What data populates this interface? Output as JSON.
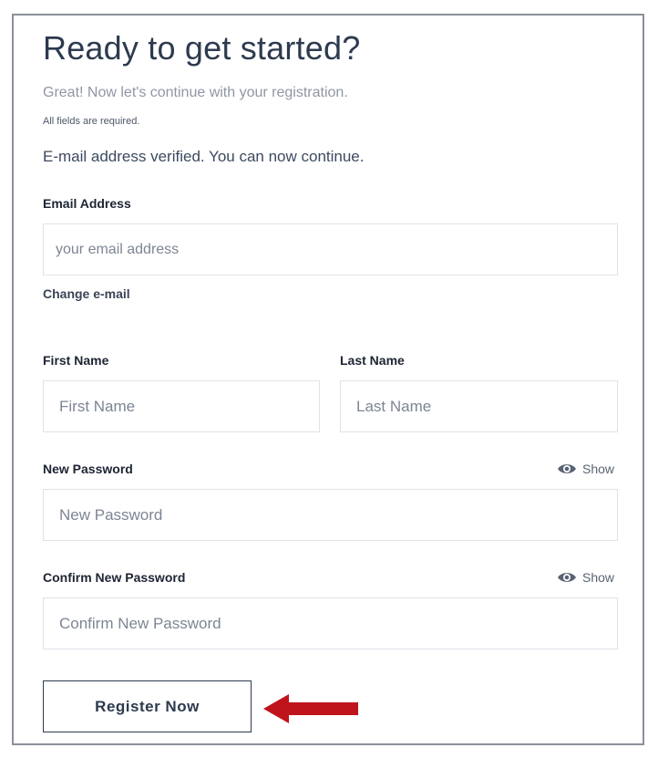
{
  "header": {
    "title": "Ready to get started?",
    "subtitle": "Great! Now let's continue with your registration.",
    "required_note": "All fields are required.",
    "verified_message": "E-mail address verified. You can now continue."
  },
  "form": {
    "email": {
      "label": "Email Address",
      "placeholder": "your email address",
      "value": ""
    },
    "change_email_link": "Change e-mail",
    "first_name": {
      "label": "First Name",
      "placeholder": "First Name",
      "value": ""
    },
    "last_name": {
      "label": "Last Name",
      "placeholder": "Last Name",
      "value": ""
    },
    "new_password": {
      "label": "New Password",
      "placeholder": "New Password",
      "value": "",
      "show_label": "Show"
    },
    "confirm_password": {
      "label": "Confirm New Password",
      "placeholder": "Confirm New Password",
      "value": "",
      "show_label": "Show"
    },
    "submit_label": "Register Now"
  },
  "icons": {
    "show_password": "eye-icon",
    "callout": "arrow-left-icon"
  },
  "colors": {
    "heading": "#2d3a4f",
    "muted_text": "#8f96a3",
    "field_border": "#dfe2e7",
    "frame_border": "#8a8f9a",
    "annotation_arrow": "#c0141c"
  }
}
